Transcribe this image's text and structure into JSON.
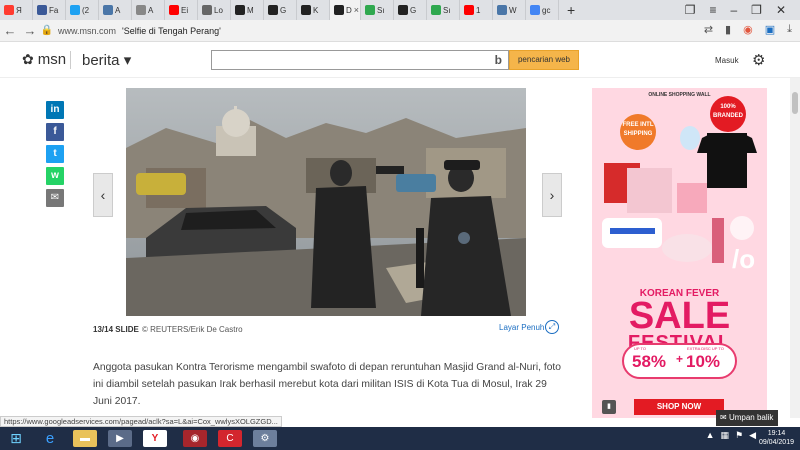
{
  "browser": {
    "tabs": [
      {
        "label": "Я",
        "color": "#ff3b30"
      },
      {
        "label": "Fa",
        "color": "#3b5998"
      },
      {
        "label": "(2",
        "color": "#1da1f2"
      },
      {
        "label": "A",
        "color": "#4a76a8"
      },
      {
        "label": "A",
        "color": "#888888"
      },
      {
        "label": "Ei",
        "color": "#ff0000"
      },
      {
        "label": "Lo",
        "color": "#666666"
      },
      {
        "label": "M",
        "color": "#222222"
      },
      {
        "label": "G",
        "color": "#222222"
      },
      {
        "label": "K",
        "color": "#222222"
      },
      {
        "label": "D",
        "color": "#222222"
      },
      {
        "label": "Sı",
        "color": "#2fa84f"
      },
      {
        "label": "G",
        "color": "#222222"
      },
      {
        "label": "Sı",
        "color": "#2fa84f"
      },
      {
        "label": "1",
        "color": "#ff0000"
      },
      {
        "label": "W",
        "color": "#4a76a8"
      },
      {
        "label": "gc",
        "color": "#4285f4"
      }
    ],
    "active_tab_index": 10,
    "new_tab": "+",
    "url": "www.msn.com",
    "page_title": "'Selfie di Tengah Perang'"
  },
  "header": {
    "logo": "msn",
    "section": "berita ▾",
    "search_button": "pencarian web",
    "signin": "Masuk"
  },
  "share_icons": [
    {
      "name": "linkedin",
      "glyph": "in",
      "color": "#0077b5"
    },
    {
      "name": "facebook",
      "glyph": "f",
      "color": "#3b5998"
    },
    {
      "name": "twitter",
      "glyph": "t",
      "color": "#1da1f2"
    },
    {
      "name": "whatsapp",
      "glyph": "w",
      "color": "#25d366"
    },
    {
      "name": "email",
      "glyph": "✉",
      "color": "#777777"
    }
  ],
  "slideshow": {
    "counter": "13/14 SLIDE",
    "credit": "© REUTERS/Erik De Castro",
    "fullscreen": "Layar Penuh",
    "caption": "Anggota pasukan Kontra Terorisme mengambil swafoto di depan reruntuhan Masjid Grand al-Nuri, foto ini diambil setelah pasukan Irak berhasil merebut kota dari militan ISIS di Kota Tua di Mosul, Irak 29 Juni 2017."
  },
  "ad": {
    "top_text": "ONLINE SHOPPING WALL",
    "badge_free": "FREE INTL SHIPPING",
    "badge_branded": "100% BRANDED",
    "line1": "KOREAN FEVER",
    "line2": "SALE",
    "line3": "FESTIVAL",
    "upto1": "UP TO",
    "pct1": "58%",
    "plus": "+",
    "upto2": "EXTRA DISC UP TO",
    "pct2": "10%",
    "cta": "SHOP NOW"
  },
  "feedback": "Umpan balik",
  "statusbar": "https://www.googleadservices.com/pagead/aclk?sa=L&ai=Cox_wwlysXOLGZGD...",
  "taskbar": {
    "time": "19:14",
    "date": "09/04/2019"
  }
}
